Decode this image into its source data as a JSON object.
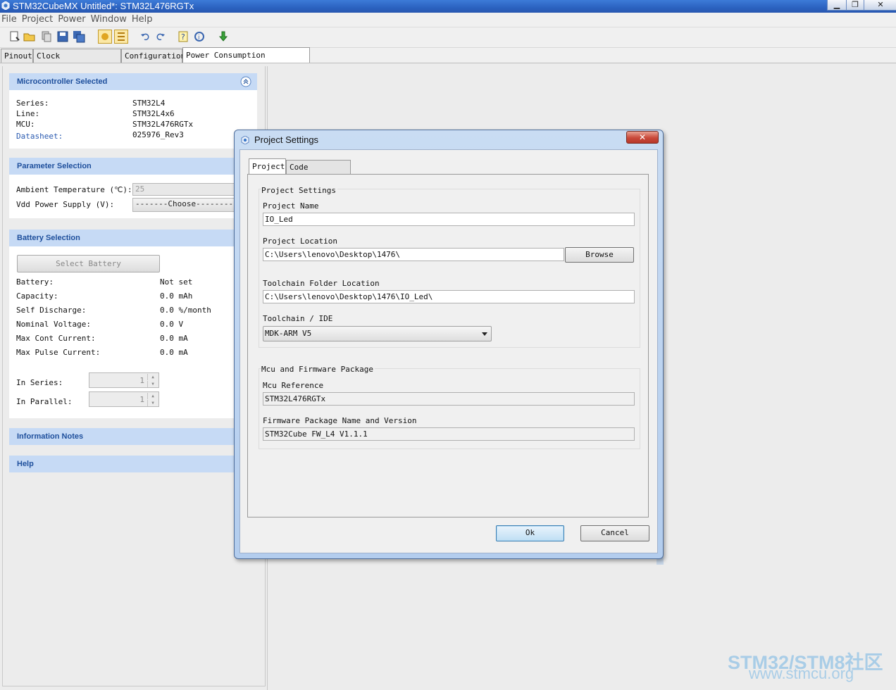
{
  "window": {
    "title": "STM32CubeMX Untitled*: STM32L476RGTx"
  },
  "menu": [
    "File",
    "Project",
    "Power",
    "Window",
    "Help"
  ],
  "tabs": [
    "Pinout",
    "Clock Configuration",
    "Configuration",
    "Power Consumption Calculator"
  ],
  "mcu_section": {
    "header": "Microcontroller Selected",
    "series_label": "Series:",
    "series_value": "STM32L4",
    "line_label": "Line:",
    "line_value": "STM32L4x6",
    "mcu_label": "MCU:",
    "mcu_value": "STM32L476RGTx",
    "datasheet_label": "Datasheet:",
    "datasheet_value": "025976_Rev3"
  },
  "param_section": {
    "header": "Parameter Selection",
    "temp_label": "Ambient Temperature (℃):",
    "temp_value": "25",
    "vdd_label": "Vdd Power Supply (V):",
    "vdd_value": "-------Choose--------"
  },
  "battery_section": {
    "header": "Battery Selection",
    "select_button": "Select Battery",
    "rows": [
      {
        "label": "Battery:",
        "value": "Not set"
      },
      {
        "label": "Capacity:",
        "value": "0.0 mAh"
      },
      {
        "label": "Self Discharge:",
        "value": "0.0 %/month"
      },
      {
        "label": "Nominal Voltage:",
        "value": "0.0 V"
      },
      {
        "label": "Max Cont Current:",
        "value": "0.0 mA"
      },
      {
        "label": "Max Pulse Current:",
        "value": "0.0 mA"
      }
    ],
    "in_series_label": "In Series:",
    "in_series_value": "1",
    "in_parallel_label": "In Parallel:",
    "in_parallel_value": "1"
  },
  "info_section": {
    "header": "Information Notes"
  },
  "help_section": {
    "header": "Help"
  },
  "dialog": {
    "title": "Project Settings",
    "close_glyph": "✕",
    "tabs": [
      "Project",
      "Code Generator"
    ],
    "project_group": "Project Settings",
    "project_name_label": "Project Name",
    "project_name_value": "IO_Led",
    "project_location_label": "Project Location",
    "project_location_value": "C:\\Users\\lenovo\\Desktop\\1476\\",
    "browse_button": "Browse",
    "toolchain_folder_label": "Toolchain Folder Location",
    "toolchain_folder_value": "C:\\Users\\lenovo\\Desktop\\1476\\IO_Led\\",
    "toolchain_ide_label": "Toolchain / IDE",
    "toolchain_ide_value": "MDK-ARM V5",
    "mcu_group": "Mcu and Firmware Package",
    "mcu_ref_label": "Mcu Reference",
    "mcu_ref_value": "STM32L476RGTx",
    "fw_label": "Firmware Package Name and Version",
    "fw_value": "STM32Cube FW_L4 V1.1.1",
    "ok_button": "Ok",
    "cancel_button": "Cancel"
  },
  "watermark": {
    "line1": "STM32/STM8社区",
    "line2": "www.stmcu.org"
  },
  "colors": {
    "section_header_bg": "#c6daf5",
    "section_header_text": "#1e4f9c",
    "titlebar": "#2b62c0"
  }
}
